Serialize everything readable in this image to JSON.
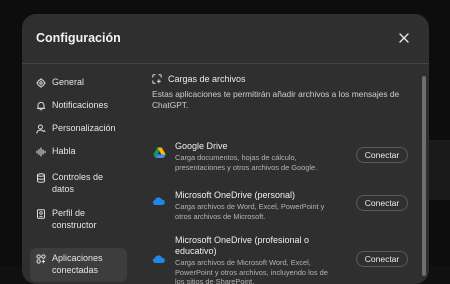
{
  "dialog": {
    "title": "Configuración",
    "close_icon": "close-icon"
  },
  "sidebar": {
    "items": [
      {
        "label": "General",
        "icon": "gear-icon",
        "active": false
      },
      {
        "label": "Notificaciones",
        "icon": "bell-icon",
        "active": false
      },
      {
        "label": "Personalización",
        "icon": "person-icon",
        "active": false
      },
      {
        "label": "Habla",
        "icon": "waveform-icon",
        "active": false
      },
      {
        "label": "Controles de datos",
        "icon": "database-icon",
        "active": false
      },
      {
        "label": "Perfil de constructor",
        "icon": "id-card-icon",
        "active": false
      },
      {
        "label": "Aplicaciones conectadas",
        "icon": "apps-icon",
        "active": true
      }
    ]
  },
  "content": {
    "section_title": "Cargas de archivos",
    "section_icon": "file-upload-icon",
    "section_description": "Estas aplicaciones te permitirán añadir archivos a los mensajes de ChatGPT.",
    "integrations": [
      {
        "name": "Google Drive",
        "icon": "google-drive-icon",
        "description": "Carga documentos, hojas de cálculo, presentaciones y otros archivos de Google.",
        "action": "Conectar"
      },
      {
        "name": "Microsoft OneDrive (personal)",
        "icon": "onedrive-icon",
        "description": "Carga archivos de Word, Excel, PowerPoint y otros archivos de Microsoft.",
        "action": "Conectar"
      },
      {
        "name": "Microsoft OneDrive (profesional o educativo)",
        "icon": "onedrive-icon",
        "description": "Carga archivos de Microsoft Word, Excel, PowerPoint y otros archivos, incluyendo los de los sitios de SharePoint.",
        "action": "Conectar"
      }
    ]
  },
  "colors": {
    "modal_bg": "#2f2f2f",
    "active_item_bg": "#3d3d3d",
    "text": "#ececec",
    "muted_text": "#b4b4b4",
    "onedrive_blue": "#1e88e5"
  }
}
